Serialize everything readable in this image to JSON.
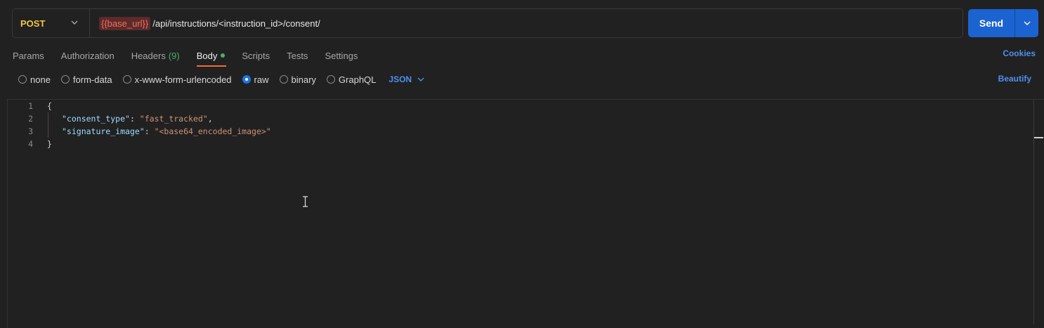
{
  "request": {
    "method": "POST",
    "url_variable": "{{base_url}}",
    "url_path": "/api/instructions/<instruction_id>/consent/",
    "send_label": "Send"
  },
  "tabs": [
    {
      "label": "Params"
    },
    {
      "label": "Authorization"
    },
    {
      "label": "Headers",
      "count": "(9)"
    },
    {
      "label": "Body",
      "active": true
    },
    {
      "label": "Scripts"
    },
    {
      "label": "Tests"
    },
    {
      "label": "Settings"
    }
  ],
  "cookies_label": "Cookies",
  "body_options": [
    "none",
    "form-data",
    "x-www-form-urlencoded",
    "raw",
    "binary",
    "GraphQL"
  ],
  "body_selected": "raw",
  "language": "JSON",
  "beautify_label": "Beautify",
  "editor": {
    "lines": [
      {
        "num": "1",
        "text": "{"
      },
      {
        "num": "2",
        "key": "\"consent_type\"",
        "value": "\"fast_tracked\"",
        "trail": ","
      },
      {
        "num": "3",
        "key": "\"signature_image\"",
        "value": "\"<base64_encoded_image>\"",
        "trail": ""
      },
      {
        "num": "4",
        "text": "}"
      }
    ]
  },
  "colors": {
    "method": "#f2c744",
    "send": "#1b63d1",
    "accent_link": "#4f8ff0",
    "active_tab_underline": "#f26b3a",
    "status_dot": "#4caf6e",
    "json_key": "#9cdcfe",
    "json_string": "#ce9178"
  }
}
